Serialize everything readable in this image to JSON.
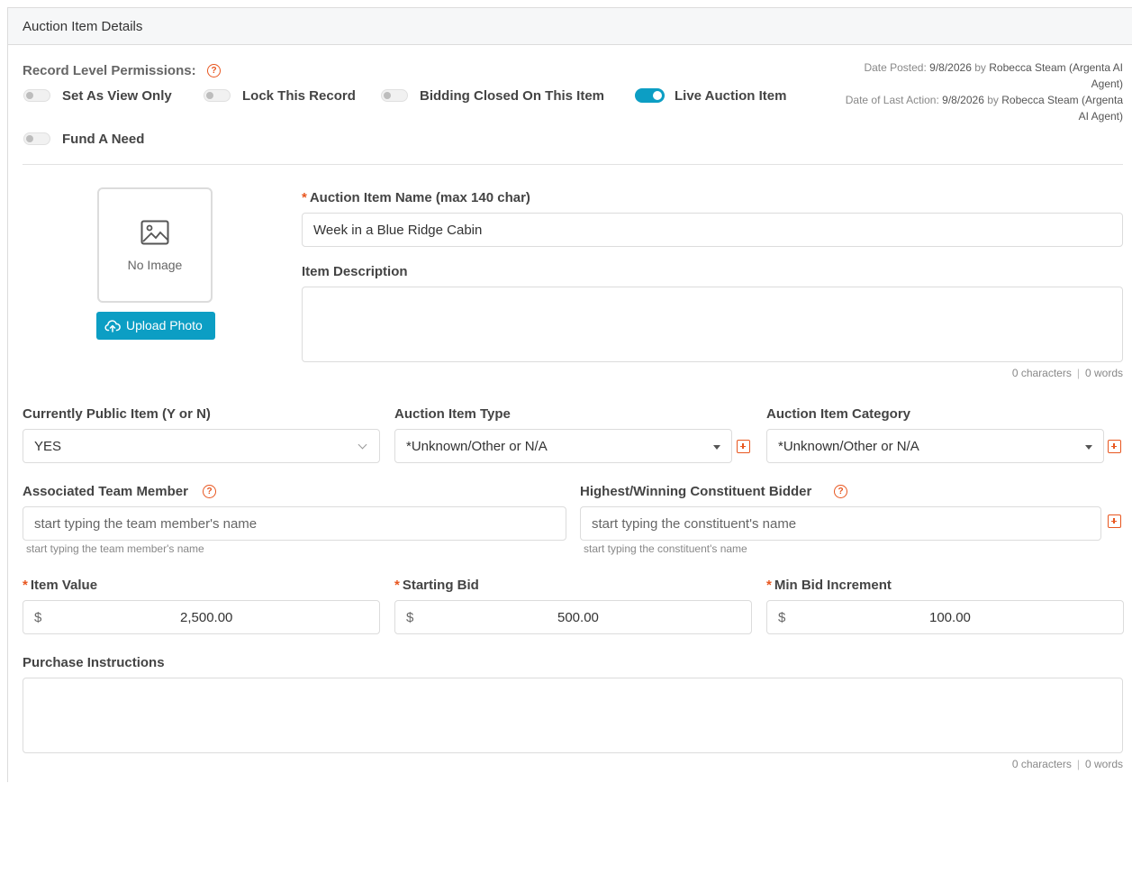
{
  "panel": {
    "title": "Auction Item Details"
  },
  "permissions": {
    "label": "Record Level Permissions:",
    "toggles": [
      {
        "label": "Set As View Only",
        "on": false
      },
      {
        "label": "Lock This Record",
        "on": false
      },
      {
        "label": "Bidding Closed On This Item",
        "on": false
      },
      {
        "label": "Live Auction Item",
        "on": true
      },
      {
        "label": "Fund A Need",
        "on": false
      }
    ]
  },
  "meta": {
    "posted_label": "Date Posted:",
    "posted_date": "9/8/2026",
    "by": "by",
    "posted_by_line1": "Robecca Steam (Argenta AI",
    "posted_by_line2": "Agent)",
    "last_action_label": "Date of Last Action:",
    "last_action_date": "9/8/2026",
    "last_action_by_line1": "Robecca Steam (Argenta",
    "last_action_by_line2": "AI Agent)"
  },
  "image": {
    "no_image_text": "No Image",
    "upload_label": "Upload Photo"
  },
  "item_name": {
    "label": "Auction Item Name (max 140 char)",
    "value": "Week in a Blue Ridge Cabin"
  },
  "description": {
    "label": "Item Description",
    "value": "",
    "chars": "0 characters",
    "sep": "|",
    "words": "0 words"
  },
  "public_item": {
    "label": "Currently Public Item (Y or N)",
    "value": "YES"
  },
  "item_type": {
    "label": "Auction Item Type",
    "value": "*Unknown/Other or N/A"
  },
  "item_category": {
    "label": "Auction Item Category",
    "value": "*Unknown/Other or N/A"
  },
  "team_member": {
    "label": "Associated Team Member",
    "placeholder": "start typing the team member's name",
    "helper": "start typing the team member's name"
  },
  "bidder": {
    "label": "Highest/Winning Constituent Bidder",
    "placeholder": "start typing the constituent's name",
    "helper": "start typing the constituent's name"
  },
  "item_value": {
    "label": "Item Value",
    "currency": "$",
    "value": "2,500.00"
  },
  "starting_bid": {
    "label": "Starting Bid",
    "currency": "$",
    "value": "500.00"
  },
  "min_increment": {
    "label": "Min Bid Increment",
    "currency": "$",
    "value": "100.00"
  },
  "purchase": {
    "label": "Purchase Instructions",
    "value": "",
    "chars": "0 characters",
    "sep": "|",
    "words": "0 words"
  },
  "icons": {
    "help": "question-circle-icon",
    "image": "image-placeholder-icon",
    "upload": "cloud-upload-icon",
    "add": "plus-square-icon",
    "dropdown": "caret-down-icon"
  },
  "colors": {
    "accent": "#0c9ec4",
    "required": "#e8561f",
    "border": "#dcdcdc"
  }
}
